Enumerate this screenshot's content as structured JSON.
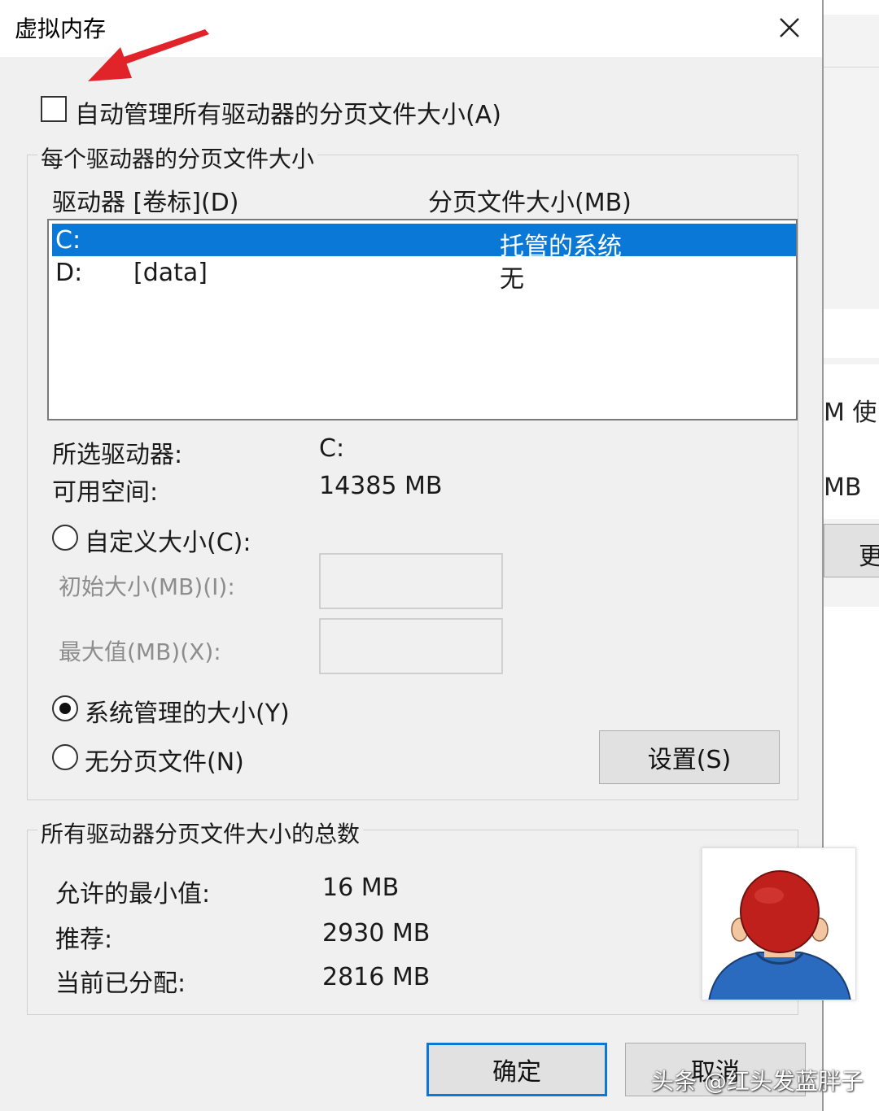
{
  "background_window": {
    "text_1": "M 使",
    "text_2": "MB",
    "button_label": "更"
  },
  "dialog": {
    "title": "虚拟内存",
    "auto_manage_label": "自动管理所有驱动器的分页文件大小(A)",
    "auto_manage_checked": false
  },
  "per_drive": {
    "legend": "每个驱动器的分页文件大小",
    "columns": {
      "drive": "驱动器 [卷标](D)",
      "size": "分页文件大小(MB)"
    },
    "rows": [
      {
        "drive": "C:",
        "label": "",
        "size": "托管的系统",
        "selected": true
      },
      {
        "drive": "D:",
        "label": "[data]",
        "size": "无",
        "selected": false
      }
    ],
    "selected_drive_label": "所选驱动器:",
    "selected_drive_value": "C:",
    "free_space_label": "可用空间:",
    "free_space_value": "14385 MB",
    "custom_size_label": "自定义大小(C):",
    "initial_size_label": "初始大小(MB)(I):",
    "max_size_label": "最大值(MB)(X):",
    "initial_size_value": "",
    "max_size_value": "",
    "system_managed_label": "系统管理的大小(Y)",
    "no_paging_label": "无分页文件(N)",
    "selected_option": "system_managed",
    "set_button": "设置(S)"
  },
  "totals": {
    "legend": "所有驱动器分页文件大小的总数",
    "min_label": "允许的最小值:",
    "min_value": "16 MB",
    "recommended_label": "推荐:",
    "recommended_value": "2930 MB",
    "current_label": "当前已分配:",
    "current_value": "2816 MB"
  },
  "buttons": {
    "ok": "确定",
    "cancel": "取消"
  },
  "watermark": "头条 @红头发蓝胖子",
  "colors": {
    "selection": "#0a78d7",
    "arrow": "#e0242a",
    "avatar_hair": "#c0201c",
    "avatar_shirt": "#2a6bbf"
  }
}
